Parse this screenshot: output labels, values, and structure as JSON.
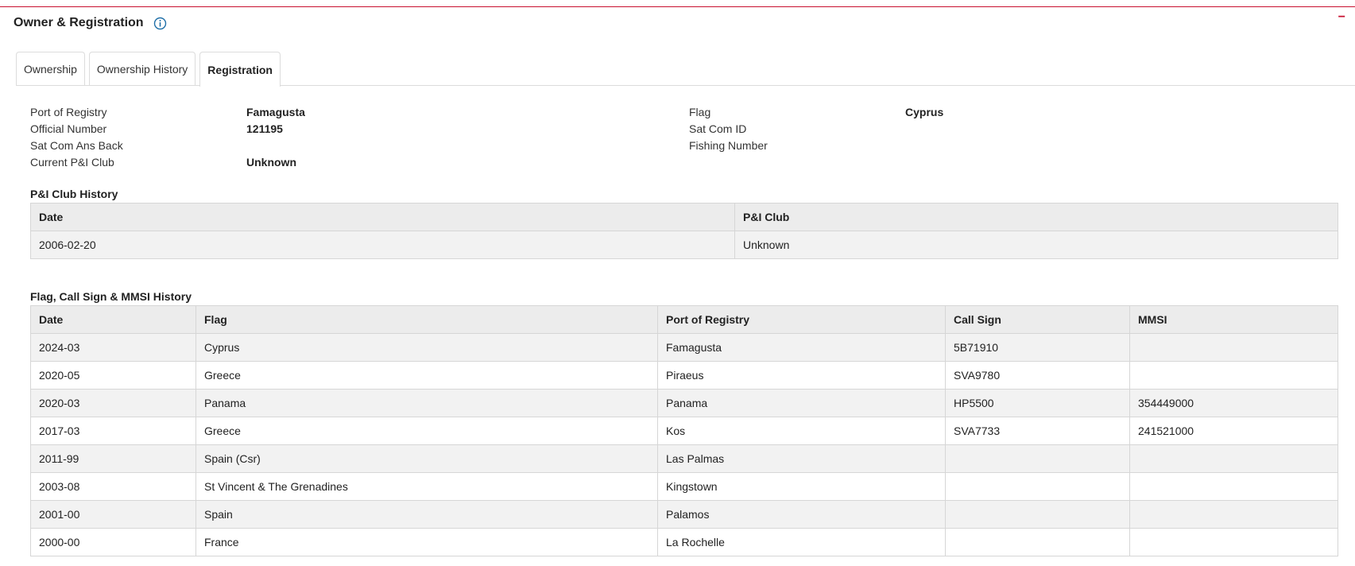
{
  "panel": {
    "title": "Owner & Registration",
    "collapse_label": "−"
  },
  "tabs": [
    {
      "label": "Ownership"
    },
    {
      "label": "Ownership History"
    },
    {
      "label": "Registration"
    }
  ],
  "registration": {
    "port_of_registry": {
      "label": "Port of Registry",
      "value": "Famagusta"
    },
    "official_number": {
      "label": "Official Number",
      "value": "121195"
    },
    "sat_com_ans_back": {
      "label": "Sat Com Ans Back",
      "value": ""
    },
    "current_pi_club": {
      "label": "Current P&I Club",
      "value": "Unknown"
    },
    "flag": {
      "label": "Flag",
      "value": "Cyprus"
    },
    "sat_com_id": {
      "label": "Sat Com ID",
      "value": ""
    },
    "fishing_number": {
      "label": "Fishing Number",
      "value": ""
    }
  },
  "pi_history": {
    "title": "P&I Club History",
    "columns": [
      "Date",
      "P&I Club"
    ],
    "rows": [
      [
        "2006-02-20",
        "Unknown"
      ]
    ]
  },
  "flag_history": {
    "title": "Flag, Call Sign & MMSI History",
    "columns": [
      "Date",
      "Flag",
      "Port of Registry",
      "Call Sign",
      "MMSI"
    ],
    "rows": [
      [
        "2024-03",
        "Cyprus",
        "Famagusta",
        "5B71910",
        ""
      ],
      [
        "2020-05",
        "Greece",
        "Piraeus",
        "SVA9780",
        ""
      ],
      [
        "2020-03",
        "Panama",
        "Panama",
        "HP5500",
        "354449000"
      ],
      [
        "2017-03",
        "Greece",
        "Kos",
        "SVA7733",
        "241521000"
      ],
      [
        "2011-99",
        "Spain (Csr)",
        "Las Palmas",
        "",
        ""
      ],
      [
        "2003-08",
        "St Vincent & The Grenadines",
        "Kingstown",
        "",
        ""
      ],
      [
        "2001-00",
        "Spain",
        "Palamos",
        "",
        ""
      ],
      [
        "2000-00",
        "France",
        "La Rochelle",
        "",
        ""
      ]
    ]
  },
  "colors": {
    "accent": "#c8102e",
    "info_icon": "#1f6fa8"
  },
  "icons": {
    "info": "info-circle-icon"
  }
}
